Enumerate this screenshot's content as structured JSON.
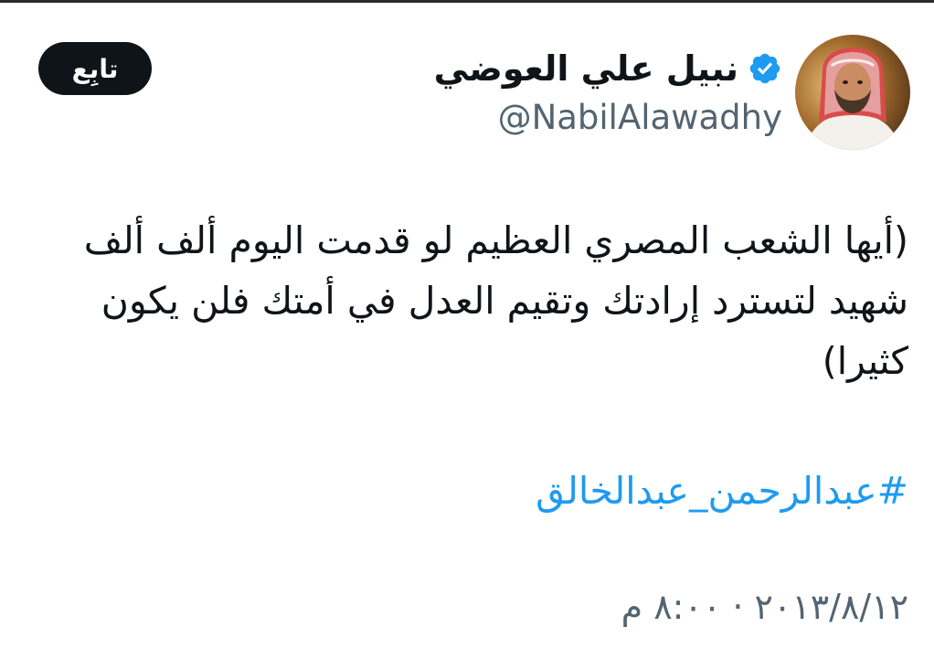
{
  "author": {
    "display_name": "نبيل علي العوضي",
    "handle": "@NabilAlawadhy",
    "verified": true,
    "avatar_icon": "profile-photo"
  },
  "follow_button": {
    "label": "تابِع"
  },
  "tweet": {
    "text": "(أيها الشعب المصري العظيم لو قدمت اليوم ألف ألف شهيد لتسترد إرادتك وتقيم العدل في أمتك فلن يكون كثيرا)",
    "hashtag": "#عبدالرحمن_عبدالخالق",
    "timestamp": "٢٠١٣/٨/١٢ · ٨:٠٠ م"
  },
  "colors": {
    "link": "#1d9bf0",
    "secondary_text": "#536471",
    "button_bg": "#0f1419",
    "verified_badge": "#1d9bf0"
  }
}
